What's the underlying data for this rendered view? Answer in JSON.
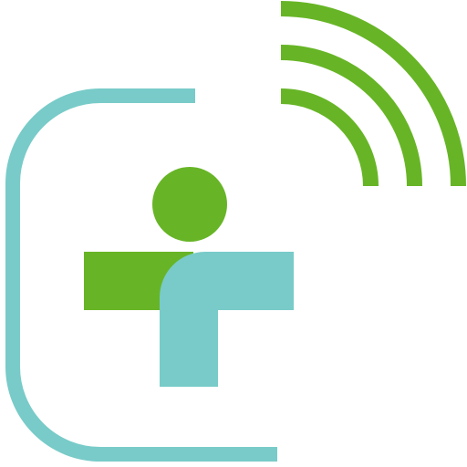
{
  "logo": {
    "icon_name": "wireless-person-logo-icon",
    "colors": {
      "teal": "#78CBC8",
      "green": "#67B526",
      "background": "#FFFFFF"
    },
    "signal_arcs": 3
  }
}
